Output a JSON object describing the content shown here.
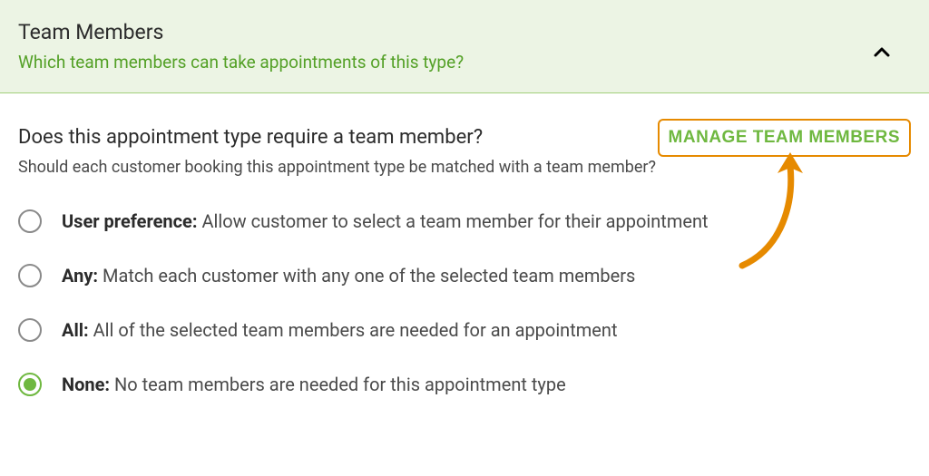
{
  "header": {
    "title": "Team Members",
    "subtitle": "Which team members can take appointments of this type?"
  },
  "content": {
    "manage_button_label": "MANAGE TEAM MEMBERS",
    "question_title": "Does this appointment type require a team member?",
    "question_subtitle": "Should each customer booking this appointment type be matched with a team member?",
    "options": [
      {
        "bold": "User preference:",
        "rest": " Allow customer to select a team member for their appointment",
        "selected": false
      },
      {
        "bold": "Any:",
        "rest": " Match each customer with any one of the selected team members",
        "selected": false
      },
      {
        "bold": "All:",
        "rest": " All of the selected team members are needed for an appointment",
        "selected": false
      },
      {
        "bold": "None:",
        "rest": " No team members are needed for this appointment type",
        "selected": true
      }
    ]
  },
  "colors": {
    "accent_green": "#6fb840",
    "header_bg": "#ecf4e4",
    "annotation_orange": "#e68a00"
  }
}
